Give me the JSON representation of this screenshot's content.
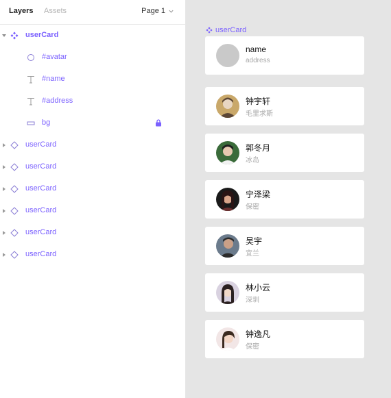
{
  "panel": {
    "tabs": {
      "layers": "Layers",
      "assets": "Assets"
    },
    "page_selector": "Page 1",
    "layers": [
      {
        "label": "userCard",
        "icon": "component-icon",
        "expanded": true
      },
      {
        "label": "#avatar",
        "icon": "ellipse-icon"
      },
      {
        "label": "#name",
        "icon": "text-icon"
      },
      {
        "label": "#address",
        "icon": "text-icon"
      },
      {
        "label": "bg",
        "icon": "rectangle-icon",
        "locked": true
      },
      {
        "label": "userCard",
        "icon": "instance-icon"
      },
      {
        "label": "userCard",
        "icon": "instance-icon"
      },
      {
        "label": "userCard",
        "icon": "instance-icon"
      },
      {
        "label": "userCard",
        "icon": "instance-icon"
      },
      {
        "label": "userCard",
        "icon": "instance-icon"
      },
      {
        "label": "userCard",
        "icon": "instance-icon"
      }
    ]
  },
  "canvas": {
    "frame_label": "userCard",
    "template_card": {
      "name": "name",
      "address": "address"
    },
    "cards": [
      {
        "name": "钟宇轩",
        "address": "毛里求斯",
        "avatar_colors": [
          "#c9a86a",
          "#5b4636",
          "#e8d6c2"
        ]
      },
      {
        "name": "郭冬月",
        "address": "冰岛",
        "avatar_colors": [
          "#3a6b3a",
          "#1f1f1f",
          "#e6c8b0"
        ]
      },
      {
        "name": "宁泽梁",
        "address": "保密",
        "avatar_colors": [
          "#6b2f2f",
          "#1a1a1a",
          "#d9a58a"
        ]
      },
      {
        "name": "吴宇",
        "address": "宜兰",
        "avatar_colors": [
          "#6b7b8c",
          "#2b2b2b",
          "#caa087"
        ]
      },
      {
        "name": "林小云",
        "address": "深圳",
        "avatar_colors": [
          "#d9d2e0",
          "#2a2020",
          "#f0d8c8"
        ]
      },
      {
        "name": "钟逸凡",
        "address": "保密",
        "avatar_colors": [
          "#f2e6e6",
          "#3b2a20",
          "#f3d6c6"
        ]
      }
    ]
  },
  "colors": {
    "accent": "#7b61ff",
    "canvas_bg": "#e5e5e5",
    "muted_text": "#a6a6a6"
  }
}
